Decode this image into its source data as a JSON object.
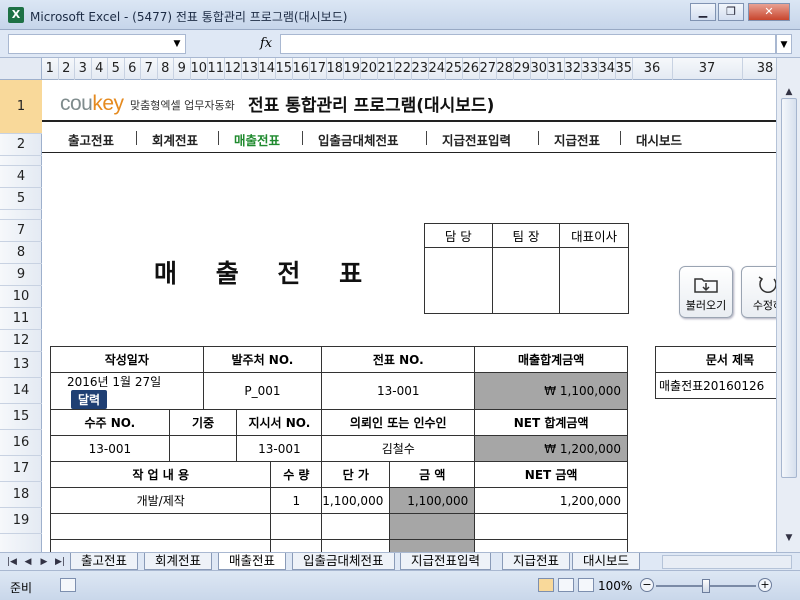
{
  "window": {
    "title": "Microsoft Excel - (5477) 전표 통합관리 프로그램(대시보드)",
    "app_icon": "X"
  },
  "formula_bar": {
    "fx": "fx",
    "value": ""
  },
  "columns": [
    "1",
    "2",
    "3",
    "4",
    "5",
    "6",
    "7",
    "8",
    "9",
    "10",
    "11",
    "12",
    "13",
    "14",
    "15",
    "16",
    "17",
    "18",
    "19",
    "20",
    "21",
    "22",
    "23",
    "24",
    "25",
    "26",
    "27",
    "28",
    "29",
    "30",
    "31",
    "32",
    "33",
    "34",
    "35",
    "36",
    "37",
    "38"
  ],
  "rows": [
    "1",
    "2",
    "",
    "4",
    "5",
    "",
    "7",
    "8",
    "9",
    "10",
    "11",
    "12",
    "13",
    "14",
    "15",
    "16",
    "17",
    "18",
    "19"
  ],
  "logo": {
    "brand_co": "cou",
    "brand_key": "key",
    "subtitle": "맞춤형엑셀 업무자동화"
  },
  "app_title": "전표 통합관리 프로그램(대시보드)",
  "nav": [
    "출고전표",
    "회계전표",
    "매출전표",
    "입출금대체전표",
    "지급전표입력",
    "지급전표",
    "대시보드"
  ],
  "nav_active": 2,
  "doc_title": "매 출 전 표",
  "approval": {
    "headers": [
      "담 당",
      "팀 장",
      "대표이사"
    ]
  },
  "buttons": {
    "load": "불러오기",
    "edit": "수정하"
  },
  "main_table": {
    "h_date": "작성일자",
    "h_vendor": "발주처 NO.",
    "h_slip": "전표 NO.",
    "h_total": "매출합계금액",
    "date": "2016년 1월 27일",
    "date_btn": "달력",
    "vendor": "P_001",
    "slip": "13-001",
    "total": "₩  1,100,000",
    "h_order": "수주 NO.",
    "h_period": "기중",
    "h_instr": "지시서 NO.",
    "h_client": "의뢰인 또는 인수인",
    "h_net": "NET 합계금액",
    "order": "13-001",
    "period": "",
    "instr": "13-001",
    "client": "김철수",
    "net": "₩  1,200,000",
    "h_work": "작 업 내 용",
    "h_qty": "수 량",
    "h_price": "단 가",
    "h_amount": "금  액",
    "h_netamt": "NET 금액",
    "items": [
      {
        "work": "개발/제작",
        "qty": "1",
        "price": "1,100,000",
        "amount": "1,100,000",
        "net": "1,200,000"
      }
    ]
  },
  "doc_name": {
    "header": "문서 제목",
    "value": "매출전표20160126"
  },
  "sheet_tabs": [
    "출고전표",
    "회계전표",
    "매출전표",
    "입출금대체전표",
    "지급전표입력",
    "지급전표",
    "대시보드"
  ],
  "active_tab": 2,
  "status": {
    "text": "준비",
    "zoom": "100%"
  }
}
